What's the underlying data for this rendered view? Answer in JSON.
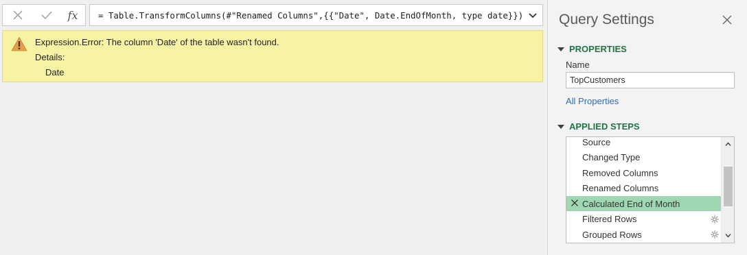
{
  "formula_bar": {
    "cancel_icon": "close-icon",
    "commit_icon": "checkmark-icon",
    "fx_label": "fx",
    "formula": "= Table.TransformColumns(#\"Renamed Columns\",{{\"Date\", Date.EndOfMonth, type date}})",
    "expand_icon": "chevron-down-icon"
  },
  "error": {
    "icon": "warning-icon",
    "message": "Expression.Error: The column 'Date' of the table wasn't found.",
    "details_label": "Details:",
    "details_value": "Date",
    "background": "#f6f3a4"
  },
  "query_settings": {
    "title": "Query Settings",
    "properties_header": "PROPERTIES",
    "name_label": "Name",
    "name_value": "TopCustomers",
    "all_properties_link": "All Properties",
    "applied_steps_header": "APPLIED STEPS",
    "accent_color": "#217346",
    "steps": [
      {
        "label": "Source",
        "selected": false,
        "error": false,
        "settings": false
      },
      {
        "label": "Changed Type",
        "selected": false,
        "error": false,
        "settings": false
      },
      {
        "label": "Removed Columns",
        "selected": false,
        "error": false,
        "settings": false
      },
      {
        "label": "Renamed Columns",
        "selected": false,
        "error": false,
        "settings": false
      },
      {
        "label": "Calculated End of Month",
        "selected": true,
        "error": true,
        "settings": false
      },
      {
        "label": "Filtered Rows",
        "selected": false,
        "error": false,
        "settings": true
      },
      {
        "label": "Grouped Rows",
        "selected": false,
        "error": false,
        "settings": true
      }
    ],
    "selected_step_color": "#9fd7b3"
  }
}
